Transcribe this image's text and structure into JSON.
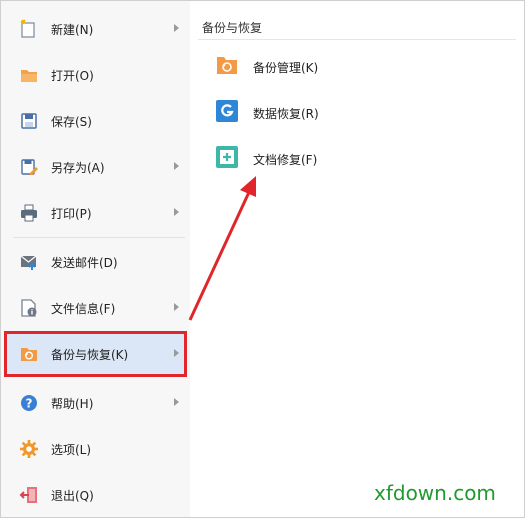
{
  "menu": {
    "items": [
      {
        "label": "新建(N)",
        "icon": "new-file-icon",
        "has_submenu": true
      },
      {
        "label": "打开(O)",
        "icon": "open-folder-icon",
        "has_submenu": false
      },
      {
        "label": "保存(S)",
        "icon": "save-icon",
        "has_submenu": false
      },
      {
        "label": "另存为(A)",
        "icon": "save-as-icon",
        "has_submenu": true
      },
      {
        "label": "打印(P)",
        "icon": "print-icon",
        "has_submenu": true
      },
      {
        "label": "发送邮件(D)",
        "icon": "email-icon",
        "has_submenu": false
      },
      {
        "label": "文件信息(F)",
        "icon": "file-info-icon",
        "has_submenu": true
      },
      {
        "label": "备份与恢复(K)",
        "icon": "backup-restore-icon",
        "has_submenu": true,
        "active": true
      },
      {
        "label": "帮助(H)",
        "icon": "help-icon",
        "has_submenu": true
      },
      {
        "label": "选项(L)",
        "icon": "gear-icon",
        "has_submenu": false
      },
      {
        "label": "退出(Q)",
        "icon": "exit-icon",
        "has_submenu": false
      }
    ]
  },
  "panel": {
    "title": "备份与恢复",
    "items": [
      {
        "label": "备份管理(K)",
        "icon": "backup-folder-icon"
      },
      {
        "label": "数据恢复(R)",
        "icon": "data-recovery-icon"
      },
      {
        "label": "文档修复(F)",
        "icon": "doc-repair-icon"
      }
    ]
  },
  "colors": {
    "highlight_border": "#e0262a",
    "active_bg": "#dbe6f6",
    "watermark": "#1e9a2e"
  },
  "watermark": "xfdown.com"
}
